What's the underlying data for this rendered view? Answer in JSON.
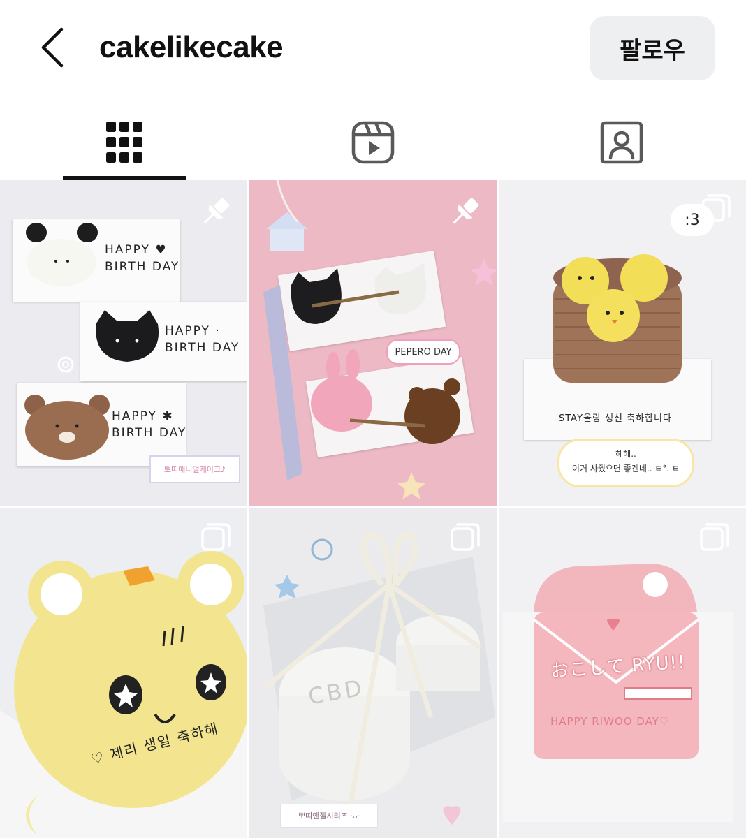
{
  "header": {
    "username": "cakelikecake",
    "follow_label": "팔로우",
    "back_icon": "chevron-left-icon"
  },
  "tabs": [
    {
      "icon": "grid-icon",
      "active": true
    },
    {
      "icon": "reels-icon",
      "active": false
    },
    {
      "icon": "tagged-icon",
      "active": false
    }
  ],
  "posts": [
    {
      "type": "pinned",
      "texts": {
        "card1": "HAPPY ♥\nBIRTH DAY",
        "card2": "HAPPY ·\nBIRTH DAY",
        "card3": "HAPPY ✱\nBIRTH DAY",
        "label": "뽀띠에니멀케이크♪"
      }
    },
    {
      "type": "pinned",
      "texts": {
        "bubble": "PEPERO DAY"
      }
    },
    {
      "type": "carousel",
      "badge_text": ":3",
      "texts": {
        "plate": "STAY올랑 생신 축하합니다",
        "bubble_line1": "헤헤..",
        "bubble_line2": "이거 사줬으면 좋겐네.. ㅌ°. ㅌ"
      }
    },
    {
      "type": "carousel",
      "texts": {
        "plate": "♡ 제리 생일 축하해"
      }
    },
    {
      "type": "carousel",
      "texts": {
        "cake": "CBD",
        "label": "뽀띠엔젤시리즈 ·ᴗ·"
      }
    },
    {
      "type": "carousel",
      "texts": {
        "cake": "おこして RYU!!",
        "plate": "HAPPY RIWOO DAY♡"
      }
    }
  ],
  "colors": {
    "text": "#111111",
    "follow_bg": "#EEEFF1",
    "tab_indicator": "#111111",
    "icon_gray": "#595959"
  }
}
